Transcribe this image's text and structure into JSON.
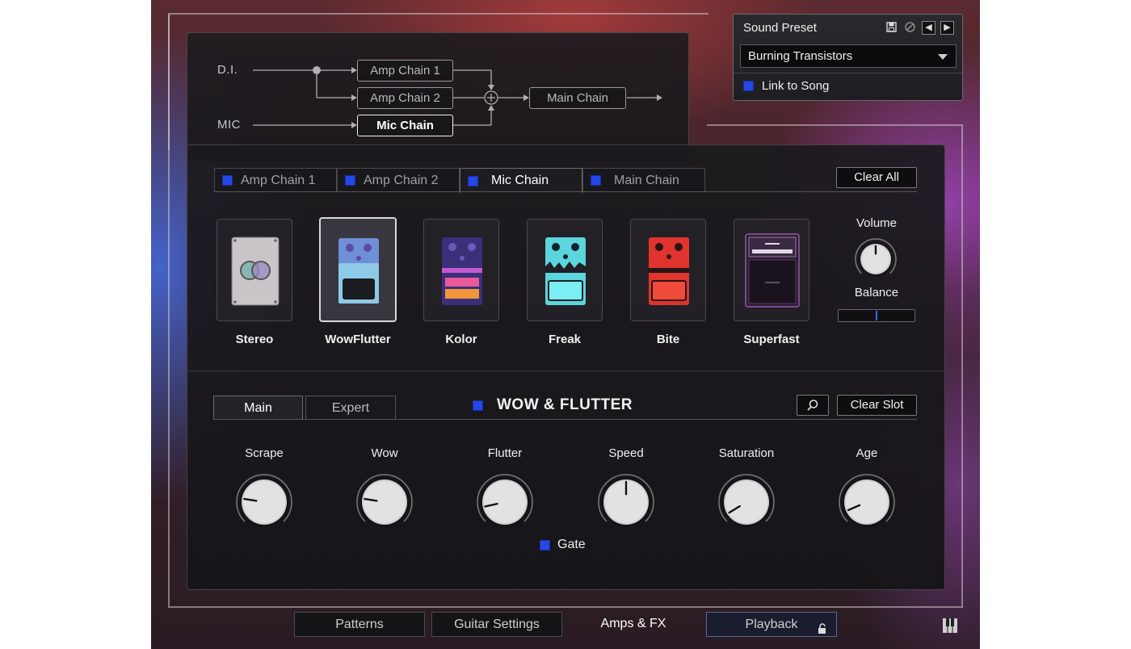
{
  "routing": {
    "inputs": [
      "D.I.",
      "MIC"
    ],
    "chains": [
      "Amp Chain 1",
      "Amp Chain 2",
      "Mic Chain"
    ],
    "output": "Main Chain",
    "active_chain": "Mic Chain"
  },
  "preset": {
    "title": "Sound Preset",
    "value": "Burning Transistors",
    "link_label": "Link to Song",
    "icons": [
      "save-icon",
      "disable-icon",
      "prev-arrow-icon",
      "next-arrow-icon"
    ]
  },
  "chain_tabs": [
    "Amp Chain 1",
    "Amp Chain 2",
    "Mic Chain",
    "Main Chain"
  ],
  "clear_all": "Clear All",
  "slots": [
    "Stereo",
    "WowFlutter",
    "Kolor",
    "Freak",
    "Bite",
    "Superfast"
  ],
  "selected_slot": "WowFlutter",
  "mix": {
    "volume_label": "Volume",
    "balance_label": "Balance",
    "balance_value": 0.5
  },
  "sub_tabs": {
    "main": "Main",
    "expert": "Expert"
  },
  "fx": {
    "title": "WOW & FLUTTER",
    "clear_slot": "Clear Slot",
    "knobs": [
      {
        "label": "Scrape",
        "value": 0.2
      },
      {
        "label": "Wow",
        "value": 0.2
      },
      {
        "label": "Flutter",
        "value": 0.12
      },
      {
        "label": "Speed",
        "value": 0.5
      },
      {
        "label": "Saturation",
        "value": 0.05
      },
      {
        "label": "Age",
        "value": 0.08
      }
    ],
    "gate_label": "Gate"
  },
  "bottom_tabs": [
    "Patterns",
    "Guitar Settings",
    "Amps & FX",
    "Playback"
  ],
  "active_bottom_tab": "Amps & FX",
  "colors": {
    "accent": "#2447e8",
    "panel": "#1c1b1f"
  }
}
